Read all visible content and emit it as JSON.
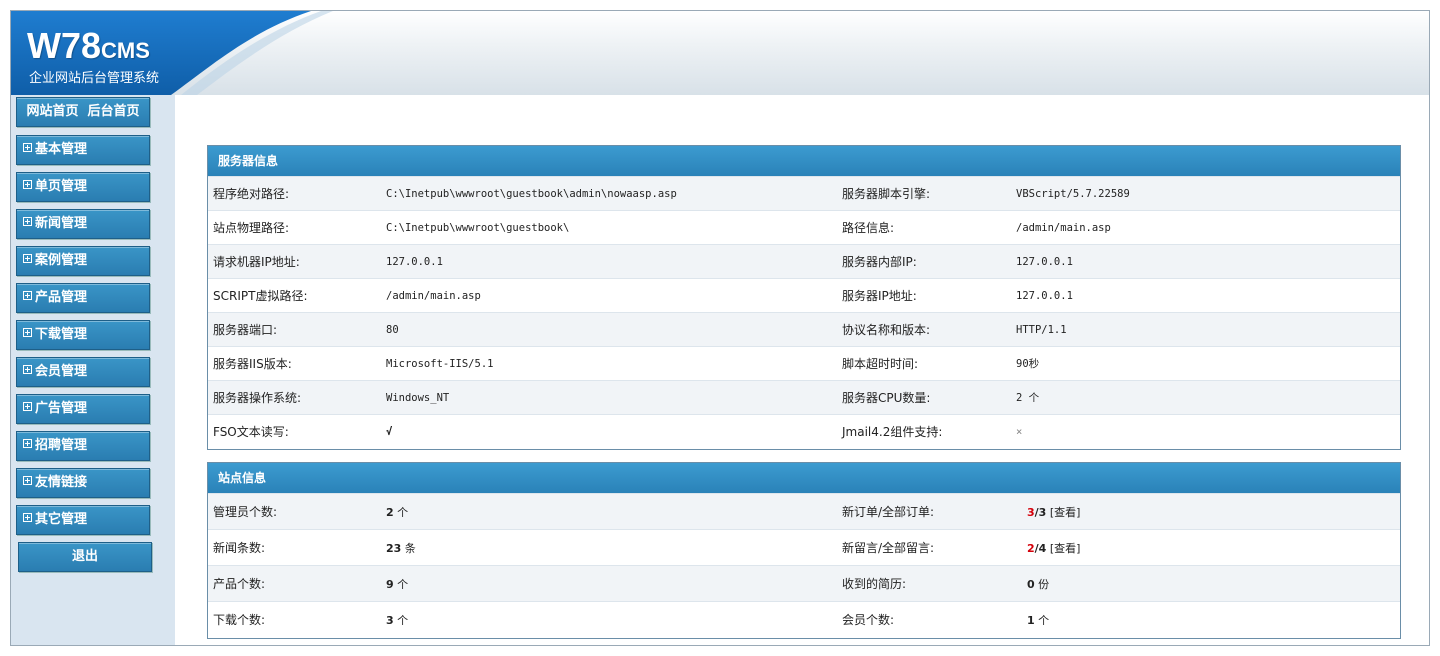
{
  "header": {
    "logo_main": "W78",
    "logo_suffix": "CMS",
    "subtitle": "企业网站后台管理系统",
    "brand_color": "#1d6fb8"
  },
  "sidebar": {
    "top_links": [
      "网站首页",
      "后台首页"
    ],
    "menu": [
      "基本管理",
      "单页管理",
      "新闻管理",
      "案例管理",
      "产品管理",
      "下载管理",
      "会员管理",
      "广告管理",
      "招聘管理",
      "友情链接",
      "其它管理"
    ],
    "exit_label": "退出"
  },
  "server_info": {
    "title": "服务器信息",
    "rows": [
      {
        "l1": "程序绝对路径:",
        "v1": "C:\\Inetpub\\wwwroot\\guestbook\\admin\\nowaasp.asp",
        "l2": "服务器脚本引擎:",
        "v2": "VBScript/5.7.22589"
      },
      {
        "l1": "站点物理路径:",
        "v1": "C:\\Inetpub\\wwwroot\\guestbook\\",
        "l2": "路径信息:",
        "v2": "/admin/main.asp"
      },
      {
        "l1": "请求机器IP地址:",
        "v1": "127.0.0.1",
        "l2": "服务器内部IP:",
        "v2": "127.0.0.1"
      },
      {
        "l1": "SCRIPT虚拟路径:",
        "v1": "/admin/main.asp",
        "l2": "服务器IP地址:",
        "v2": "127.0.0.1"
      },
      {
        "l1": "服务器端口:",
        "v1": "80",
        "l2": "协议名称和版本:",
        "v2": "HTTP/1.1"
      },
      {
        "l1": "服务器IIS版本:",
        "v1": "Microsoft-IIS/5.1",
        "l2": "脚本超时时间:",
        "v2": "90秒"
      },
      {
        "l1": "服务器操作系统:",
        "v1": "Windows_NT",
        "l2": "服务器CPU数量:",
        "v2": "2 个"
      },
      {
        "l1": "FSO文本读写:",
        "v1": "√",
        "l2": "Jmail4.2组件支持:",
        "v2": "×"
      }
    ]
  },
  "site_info": {
    "title": "站点信息",
    "rows": [
      {
        "l1": "管理员个数:",
        "n1": "2",
        "u1": " 个",
        "l2": "新订单/全部订单:",
        "red": "3",
        "rest": "/3",
        "link": " [查看]"
      },
      {
        "l1": "新闻条数:",
        "n1": "23",
        "u1": " 条",
        "l2": "新留言/全部留言:",
        "red": "2",
        "rest": "/4",
        "link": " [查看]"
      },
      {
        "l1": "产品个数:",
        "n1": "9",
        "u1": " 个",
        "l2": "收到的简历:",
        "n2": "0",
        "u2": " 份"
      },
      {
        "l1": "下载个数:",
        "n1": "3",
        "u1": " 个",
        "l2": "会员个数:",
        "n2": "1",
        "u2": " 个"
      }
    ]
  }
}
